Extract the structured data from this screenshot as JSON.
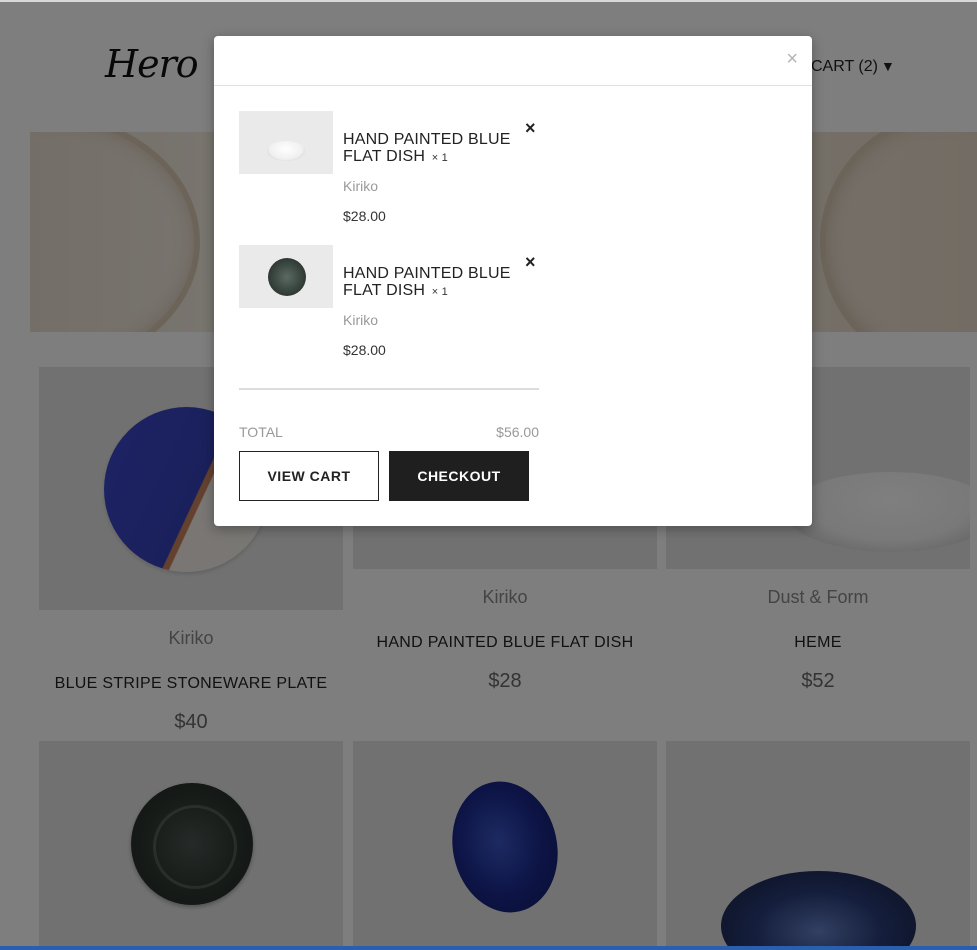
{
  "header": {
    "logo": "Hero",
    "cart_label": "CART (2)",
    "cart_caret": "▼"
  },
  "products": [
    {
      "brand": "Kiriko",
      "title": "BLUE STRIPE STONEWARE PLATE",
      "price": "$40"
    },
    {
      "brand": "Kiriko",
      "title": "HAND PAINTED BLUE FLAT DISH",
      "price": "$28"
    },
    {
      "brand": "Dust & Form",
      "title": "HEME",
      "price": "$52"
    }
  ],
  "modal": {
    "close_symbol": "×",
    "items": [
      {
        "name": "HAND PAINTED BLUE FLAT DISH",
        "qty": "× 1",
        "vendor": "Kiriko",
        "price": "$28.00",
        "remove_symbol": "×"
      },
      {
        "name": "HAND PAINTED BLUE FLAT DISH",
        "qty": "× 1",
        "vendor": "Kiriko",
        "price": "$28.00",
        "remove_symbol": "×"
      }
    ],
    "total_label": "TOTAL",
    "total_value": "$56.00",
    "view_cart_label": "VIEW CART",
    "checkout_label": "CHECKOUT"
  },
  "colors": {
    "overlay": "#000000",
    "checkout_bg": "#1f1f1f",
    "taskbar": "#2b5fae"
  }
}
